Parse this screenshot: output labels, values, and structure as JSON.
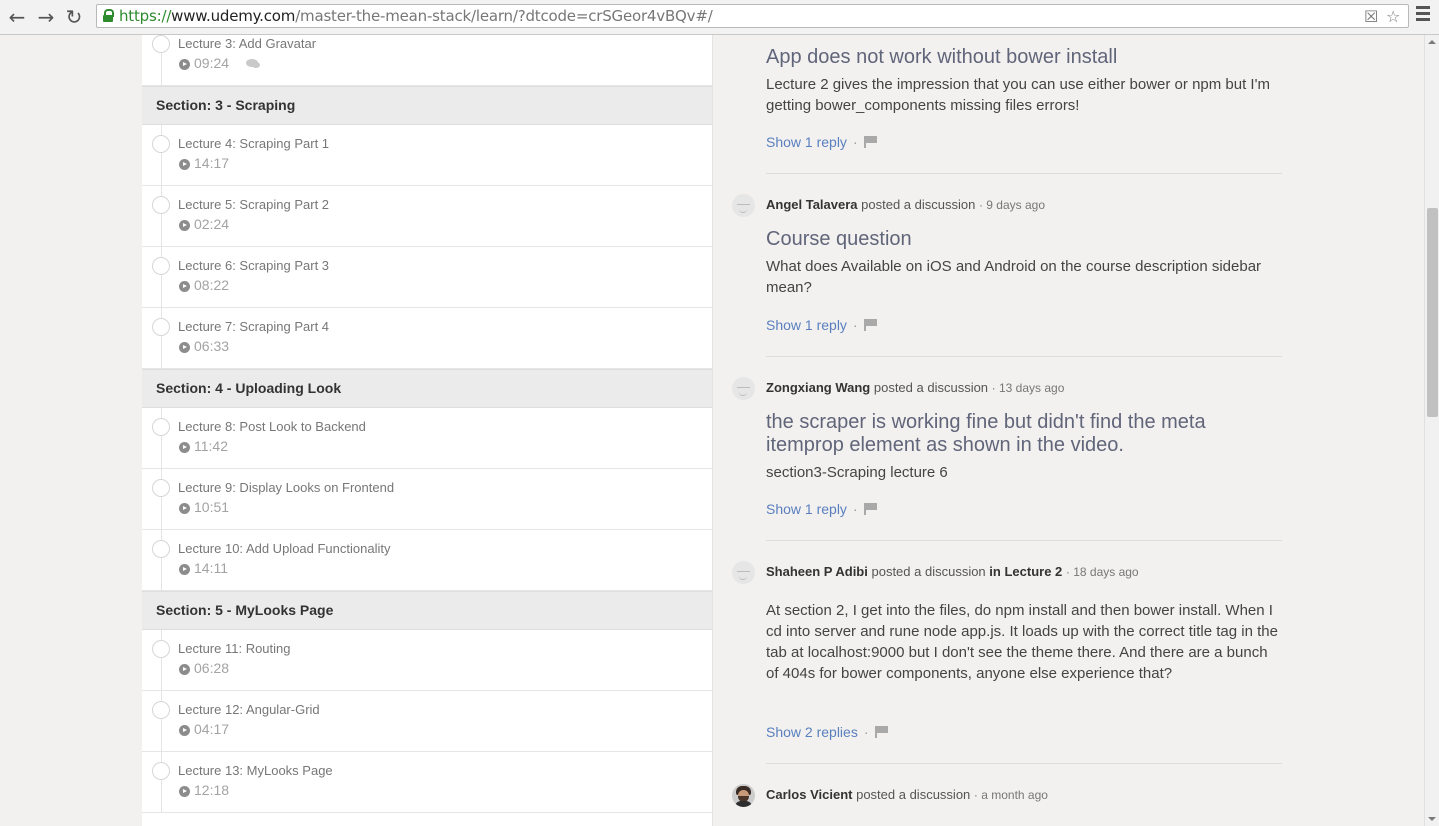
{
  "browser": {
    "url_scheme": "https://",
    "url_host": "www.udemy.com",
    "url_path": "/master-the-mean-stack/learn/?dtcode=crSGeor4vBQv#/",
    "back_icon": "←",
    "forward_icon": "→",
    "reload_icon": "↻",
    "ext_icon": "☒",
    "star_icon": "☆",
    "colors": {
      "secure": "#2e8b2e"
    }
  },
  "curriculum": {
    "items": [
      {
        "kind": "lecture",
        "title": "Lecture 3: Add Gravatar",
        "duration": "09:24",
        "has_discussion": true
      },
      {
        "kind": "section",
        "title": "Section: 3 - Scraping"
      },
      {
        "kind": "lecture",
        "title": "Lecture 4: Scraping Part 1",
        "duration": "14:17"
      },
      {
        "kind": "lecture",
        "title": "Lecture 5: Scraping Part 2",
        "duration": "02:24"
      },
      {
        "kind": "lecture",
        "title": "Lecture 6: Scraping Part 3",
        "duration": "08:22"
      },
      {
        "kind": "lecture",
        "title": "Lecture 7: Scraping Part 4",
        "duration": "06:33"
      },
      {
        "kind": "section",
        "title": "Section: 4 - Uploading Look"
      },
      {
        "kind": "lecture",
        "title": "Lecture 8: Post Look to Backend",
        "duration": "11:42"
      },
      {
        "kind": "lecture",
        "title": "Lecture 9: Display Looks on Frontend",
        "duration": "10:51"
      },
      {
        "kind": "lecture",
        "title": "Lecture 10: Add Upload Functionality",
        "duration": "14:11"
      },
      {
        "kind": "section",
        "title": "Section: 5 - MyLooks Page"
      },
      {
        "kind": "lecture",
        "title": "Lecture 11: Routing",
        "duration": "06:28"
      },
      {
        "kind": "lecture",
        "title": "Lecture 12: Angular-Grid",
        "duration": "04:17"
      },
      {
        "kind": "lecture",
        "title": "Lecture 13: MyLooks Page",
        "duration": "12:18"
      }
    ]
  },
  "discussions": [
    {
      "title": "App does not work without bower install",
      "body": "Lecture 2 gives the impression that you can use either bower or npm but I'm getting bower_components missing files errors!",
      "replies": "Show 1 reply"
    },
    {
      "author": "Angel Talavera",
      "action": "posted a discussion",
      "ago": "· 9 days ago",
      "title": "Course question",
      "body": "What does Available on iOS and Android on the course description sidebar mean?",
      "replies": "Show 1 reply"
    },
    {
      "author": "Zongxiang Wang",
      "action": "posted a discussion",
      "ago": "· 13 days ago",
      "title": "the scraper is working fine but didn't find the meta itemprop element as shown in the video.",
      "body": "section3-Scraping lecture 6",
      "replies": "Show 1 reply"
    },
    {
      "author": "Shaheen P Adibi",
      "action": "posted a discussion",
      "in_lecture": "in Lecture 2",
      "ago": "· 18 days ago",
      "body": "At section 2, I get into the files, do npm install and then bower install. When I cd into server and rune node app.js. It loads up with the correct title tag in the tab at localhost:9000 but I don't see the theme there. And there are a bunch of 404s for bower components, anyone else experience that?",
      "replies": "Show 2 replies"
    },
    {
      "author": "Carlos Vicient",
      "action": "posted a discussion",
      "ago": "· a month ago"
    }
  ]
}
